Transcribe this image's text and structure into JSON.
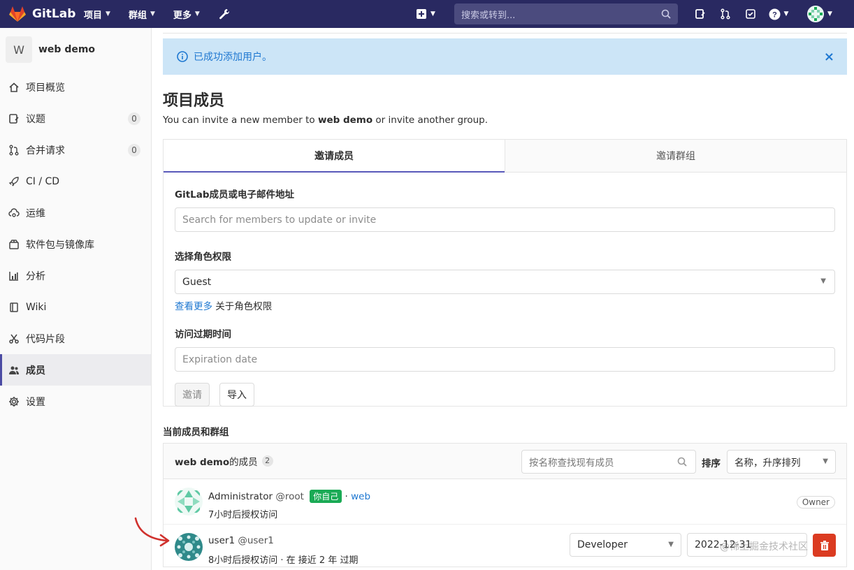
{
  "topnav": {
    "brand": "GitLab",
    "items": [
      {
        "label": "项目"
      },
      {
        "label": "群组"
      },
      {
        "label": "更多"
      }
    ],
    "search_placeholder": "搜索或转到..."
  },
  "sidebar": {
    "project_initial": "W",
    "project_name": "web demo",
    "items": [
      {
        "label": "项目概览",
        "icon": "home-icon"
      },
      {
        "label": "议题",
        "icon": "issues-icon",
        "count": "0"
      },
      {
        "label": "合并请求",
        "icon": "merge-request-icon",
        "count": "0"
      },
      {
        "label": "CI / CD",
        "icon": "rocket-icon"
      },
      {
        "label": "运维",
        "icon": "cloud-gear-icon"
      },
      {
        "label": "软件包与镜像库",
        "icon": "package-icon"
      },
      {
        "label": "分析",
        "icon": "chart-icon"
      },
      {
        "label": "Wiki",
        "icon": "book-icon"
      },
      {
        "label": "代码片段",
        "icon": "scissors-icon"
      },
      {
        "label": "成员",
        "icon": "users-icon",
        "active": true
      },
      {
        "label": "设置",
        "icon": "gear-icon"
      }
    ]
  },
  "alert": {
    "message": "已成功添加用户。",
    "close": "×"
  },
  "page": {
    "title": "项目成员",
    "subtitle_pre": "You can invite a new member to ",
    "subtitle_project": "web demo",
    "subtitle_post": " or invite another group."
  },
  "tabs": [
    {
      "label": "邀请成员",
      "active": true
    },
    {
      "label": "邀请群组",
      "active": false
    }
  ],
  "form": {
    "member_label": "GitLab成员或电子邮件地址",
    "member_placeholder": "Search for members to update or invite",
    "role_label": "选择角色权限",
    "role_value": "Guest",
    "role_link": "查看更多",
    "role_link_suffix": " 关于角色权限",
    "expiry_label": "访问过期时间",
    "expiry_placeholder": "Expiration date",
    "invite_button": "邀请",
    "import_button": "导入"
  },
  "members_section": {
    "title": "当前成员和群组",
    "header_project": "web demo",
    "header_suffix": "的成员",
    "count": "2",
    "search_placeholder": "按名称查找现有成员",
    "sort_label": "排序",
    "sort_value": "名称，升序排列"
  },
  "members": [
    {
      "name": "Administrator",
      "username": "@root",
      "badge": "你自己",
      "sep": " · ",
      "source": "web",
      "sub": "7小时后授权访问",
      "role": "Owner"
    },
    {
      "name": "user1",
      "username": "@user1",
      "sub": "8小时后授权访问 · 在 接近 2 年 过期",
      "role": "Developer",
      "expiry": "2022-12-31"
    }
  ],
  "watermark": "@稀土掘金技术社区",
  "colors": {
    "navbar": "#292961",
    "alert_bg": "#cce5f7",
    "link": "#1f78d1",
    "badge_green": "#1aaa55",
    "danger": "#db3b21",
    "tab_active": "#5859b9"
  }
}
